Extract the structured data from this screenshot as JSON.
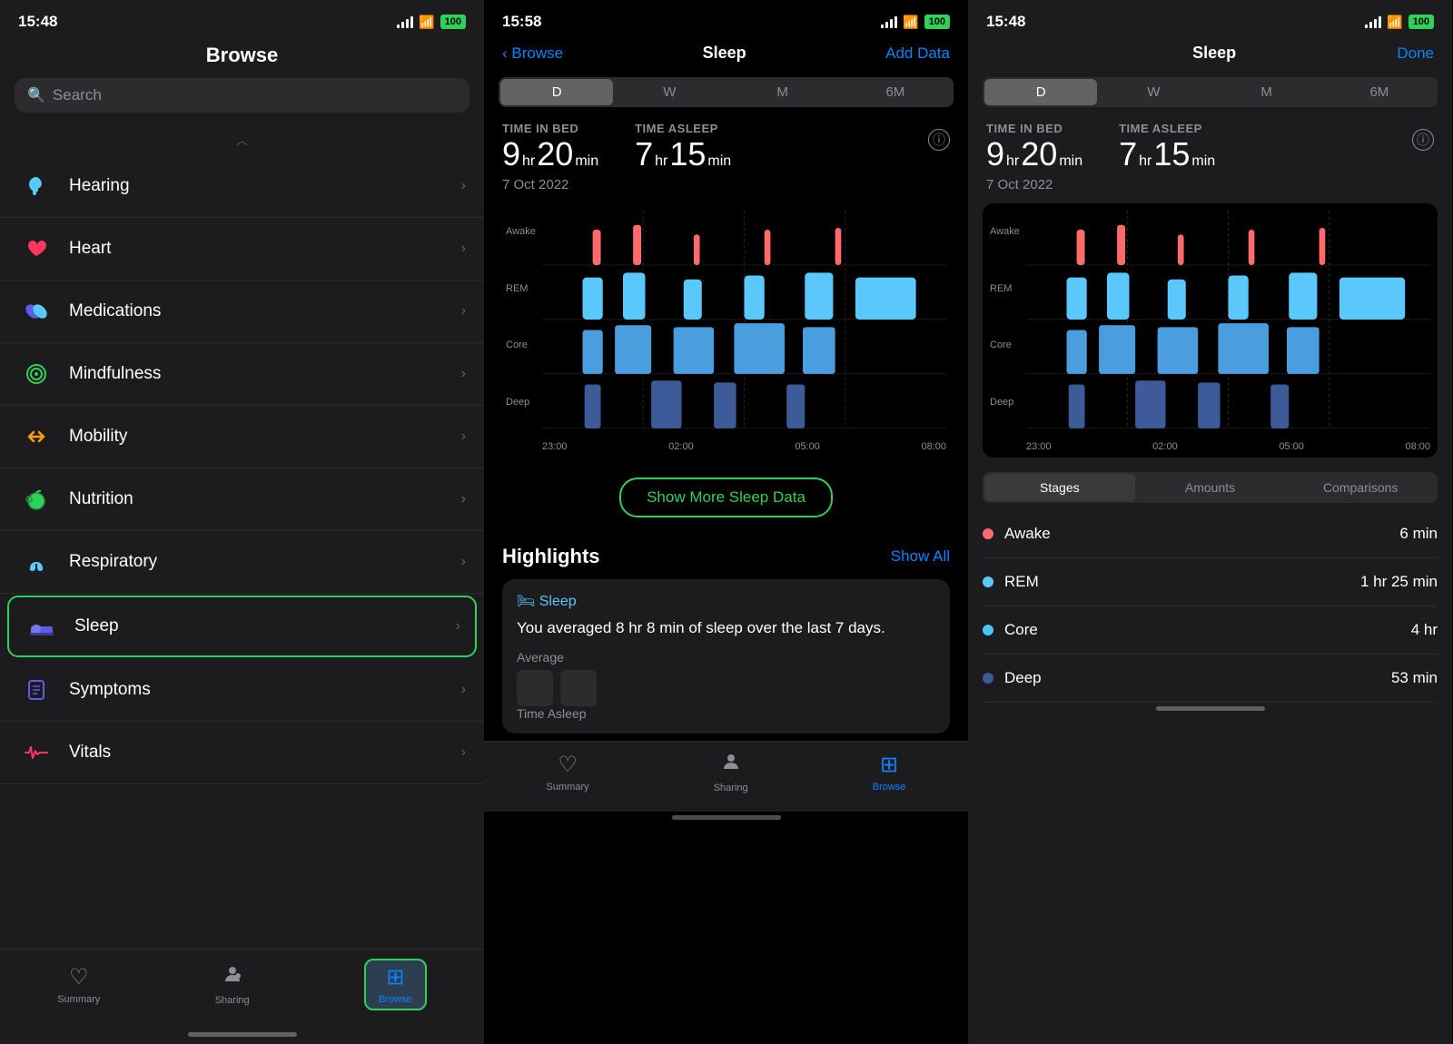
{
  "panel1": {
    "statusBar": {
      "time": "15:48",
      "battery": "100"
    },
    "title": "Browse",
    "searchPlaceholder": "Search",
    "menuItems": [
      {
        "id": "hearing",
        "label": "Hearing",
        "icon": "🔔",
        "iconClass": "icon-hearing"
      },
      {
        "id": "heart",
        "label": "Heart",
        "icon": "❤️",
        "iconClass": "icon-heart"
      },
      {
        "id": "medications",
        "label": "Medications",
        "icon": "💊",
        "iconClass": "icon-meds"
      },
      {
        "id": "mindfulness",
        "label": "Mindfulness",
        "icon": "🧘",
        "iconClass": "icon-mindfulness"
      },
      {
        "id": "mobility",
        "label": "Mobility",
        "icon": "⇄",
        "iconClass": "icon-mobility"
      },
      {
        "id": "nutrition",
        "label": "Nutrition",
        "icon": "🍎",
        "iconClass": "icon-nutrition"
      },
      {
        "id": "respiratory",
        "label": "Respiratory",
        "icon": "🫁",
        "iconClass": "icon-respiratory"
      },
      {
        "id": "sleep",
        "label": "Sleep",
        "icon": "🛏",
        "iconClass": "icon-sleep",
        "selected": true
      },
      {
        "id": "symptoms",
        "label": "Symptoms",
        "icon": "📋",
        "iconClass": "icon-symptoms"
      },
      {
        "id": "vitals",
        "label": "Vitals",
        "icon": "📈",
        "iconClass": "icon-vitals"
      }
    ],
    "tabBar": {
      "items": [
        {
          "id": "summary",
          "label": "Summary",
          "icon": "♡",
          "active": false
        },
        {
          "id": "sharing",
          "label": "Sharing",
          "icon": "👤",
          "active": false
        },
        {
          "id": "browse",
          "label": "Browse",
          "icon": "⊞",
          "active": true
        }
      ]
    }
  },
  "panel2": {
    "statusBar": {
      "time": "15:58",
      "battery": "100"
    },
    "nav": {
      "back": "Browse",
      "title": "Sleep",
      "action": "Add Data"
    },
    "tabs": [
      "D",
      "W",
      "M",
      "6M"
    ],
    "activeTab": "D",
    "stats": {
      "timeBedLabel": "TIME IN BED",
      "timeBedHr": "9",
      "timeBedMin": "20",
      "timeAsleepLabel": "TIME ASLEEP",
      "timeAsleepHr": "7",
      "timeAsleepMin": "15",
      "date": "7 Oct 2022"
    },
    "chartLabels": {
      "y": [
        "Awake",
        "REM",
        "Core",
        "Deep"
      ],
      "x": [
        "23:00",
        "02:00",
        "05:00",
        "08:00"
      ]
    },
    "showMoreBtn": "Show More Sleep Data",
    "highlights": {
      "title": "Highlights",
      "showAll": "Show All",
      "card": {
        "header": "🛏 Sleep",
        "text": "You averaged 8 hr 8 min of sleep over the last 7 days.",
        "footerLabel": "Average",
        "footerSub": "Time Asleep"
      }
    },
    "tabBar": {
      "items": [
        {
          "id": "summary",
          "label": "Summary",
          "icon": "♡",
          "active": false
        },
        {
          "id": "sharing",
          "label": "Sharing",
          "icon": "👤",
          "active": false
        },
        {
          "id": "browse",
          "label": "Browse",
          "icon": "⊞",
          "active": true
        }
      ]
    }
  },
  "panel3": {
    "statusBar": {
      "time": "15:48",
      "battery": "100"
    },
    "nav": {
      "title": "Sleep",
      "done": "Done"
    },
    "tabs": [
      "D",
      "W",
      "M",
      "6M"
    ],
    "activeTab": "D",
    "stats": {
      "timeBedLabel": "TIME IN BED",
      "timeBedHr": "9",
      "timeBedMin": "20",
      "timeAsleepLabel": "TIME ASLEEP",
      "timeAsleepHr": "7",
      "timeAsleepMin": "15",
      "date": "7 Oct 2022"
    },
    "chartLabels": {
      "y": [
        "Awake",
        "REM",
        "Core",
        "Deep"
      ],
      "x": [
        "23:00",
        "02:00",
        "05:00",
        "08:00"
      ]
    },
    "stageTabs": [
      "Stages",
      "Amounts",
      "Comparisons"
    ],
    "activeStageTab": "Stages",
    "stages": [
      {
        "name": "Awake",
        "color": "#ff6b6b",
        "duration": "6 min"
      },
      {
        "name": "REM",
        "color": "#5ac8fa",
        "duration": "1 hr 25 min"
      },
      {
        "name": "Core",
        "color": "#4fc3f7",
        "duration": "4 hr"
      },
      {
        "name": "Deep",
        "color": "#3d5a99",
        "duration": "53 min"
      }
    ]
  }
}
